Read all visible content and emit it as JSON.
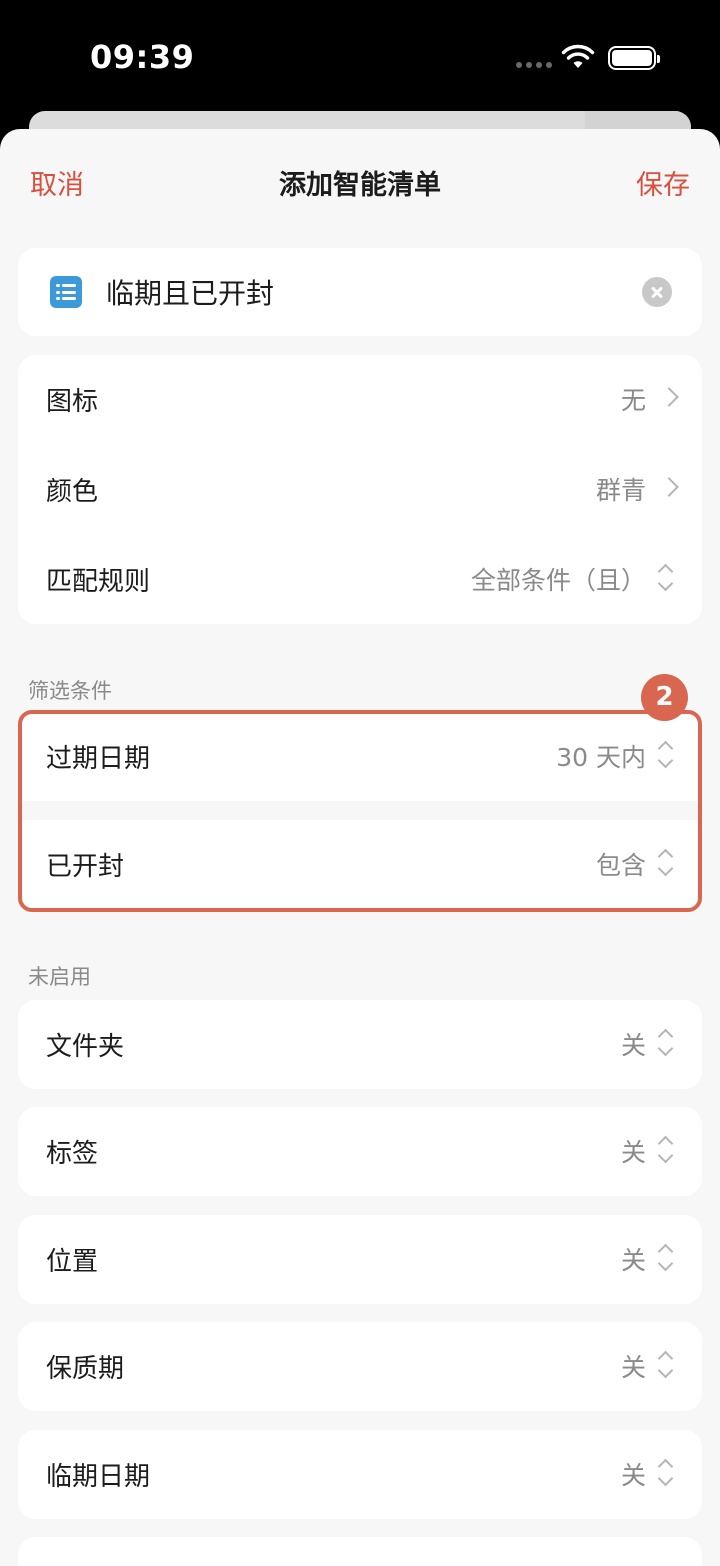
{
  "status_bar": {
    "time": "09:39"
  },
  "nav": {
    "cancel": "取消",
    "title": "添加智能清单",
    "save": "保存"
  },
  "list_name": {
    "value": "临期且已开封"
  },
  "settings": [
    {
      "label": "图标",
      "value": "无",
      "control": "chevron"
    },
    {
      "label": "颜色",
      "value": "群青",
      "control": "chevron"
    },
    {
      "label": "匹配规则",
      "value": "全部条件（且）",
      "control": "updown"
    }
  ],
  "filters": {
    "header": "筛选条件",
    "badge": "2",
    "items": [
      {
        "label": "过期日期",
        "value": "30 天内"
      },
      {
        "label": "已开封",
        "value": "包含"
      }
    ]
  },
  "disabled": {
    "header": "未启用",
    "items": [
      {
        "label": "文件夹",
        "value": "关"
      },
      {
        "label": "标签",
        "value": "关"
      },
      {
        "label": "位置",
        "value": "关"
      },
      {
        "label": "保质期",
        "value": "关"
      },
      {
        "label": "临期日期",
        "value": "关"
      }
    ]
  },
  "colors": {
    "accent": "#d9503f",
    "highlight": "#d9664f",
    "list_icon": "#3d9ad9"
  }
}
